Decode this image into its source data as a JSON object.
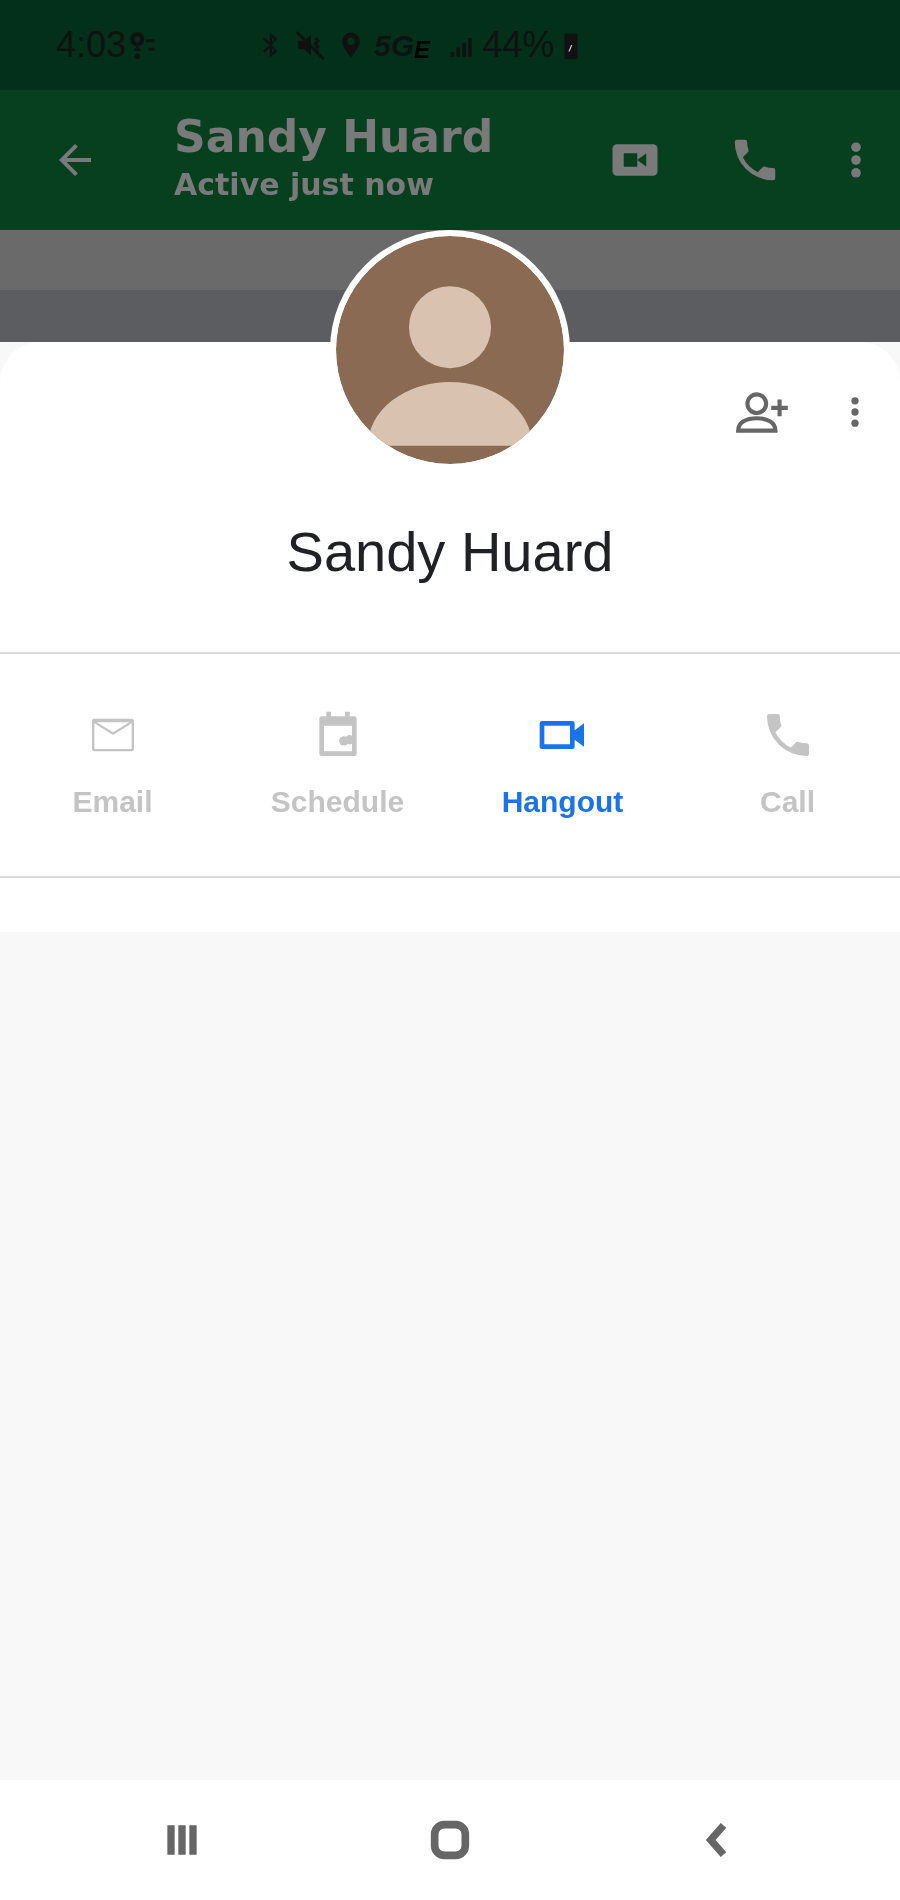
{
  "status_bar": {
    "time": "4:03",
    "network": "5G$_{E}$",
    "battery": "44%"
  },
  "chat_header": {
    "title": "Sandy Huard",
    "subtitle": "Active just now"
  },
  "contact": {
    "name": "Sandy Huard"
  },
  "actions": [
    {
      "label": "Email",
      "kind": "email",
      "selected": false
    },
    {
      "label": "Schedule",
      "kind": "schedule",
      "selected": false
    },
    {
      "label": "Hangout",
      "kind": "video",
      "selected": true
    },
    {
      "label": "Call",
      "kind": "call",
      "selected": false
    }
  ]
}
